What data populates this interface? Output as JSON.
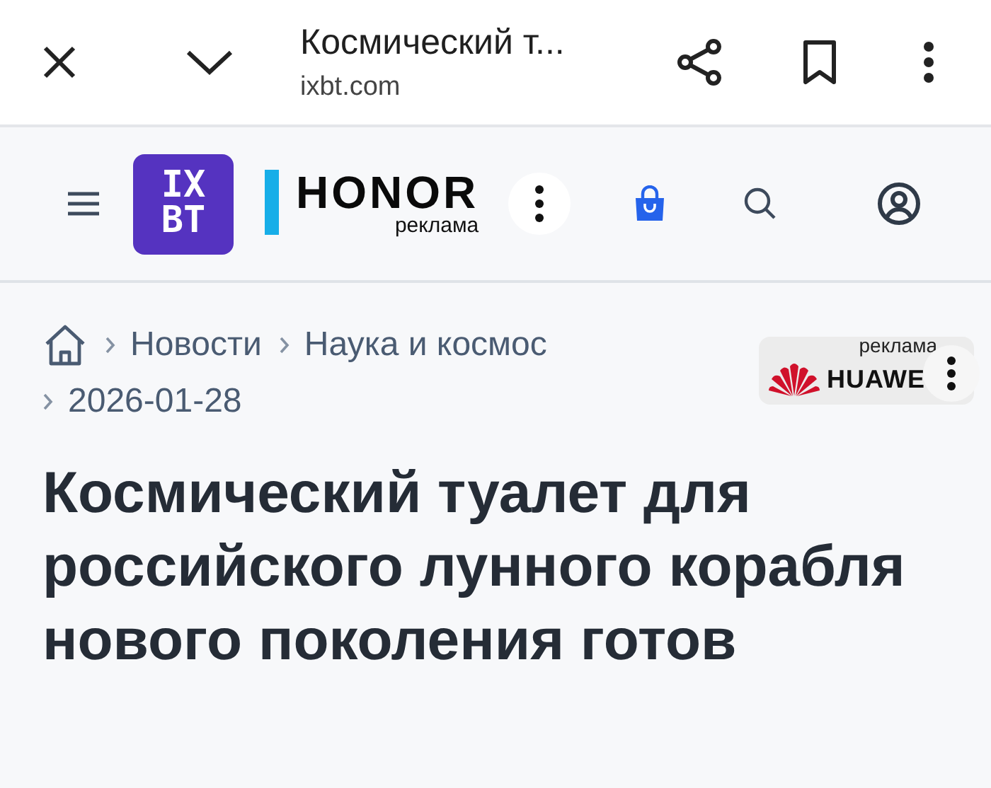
{
  "browser_bar": {
    "title": "Космический т...",
    "url": "ixbt.com"
  },
  "site_header": {
    "logo_lines": [
      "IX",
      "BT"
    ],
    "ad": {
      "brand": "HONOR",
      "label": "реклама"
    }
  },
  "breadcrumbs": [
    {
      "label": "Новости"
    },
    {
      "label": "Наука и космос"
    },
    {
      "label": "2026-01-28"
    }
  ],
  "side_ad": {
    "label": "реклама",
    "brand": "HUAWE"
  },
  "article": {
    "title": "Космический туалет для российского лунного корабля нового поколения готов"
  }
}
